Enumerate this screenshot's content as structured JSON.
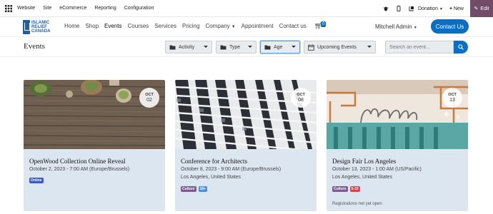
{
  "adminbar": {
    "menu": [
      "Website",
      "Site",
      "eCommerce",
      "Reporting",
      "Configuration"
    ],
    "donation_label": "Donation",
    "new_label": "New",
    "edit_label": "Edit"
  },
  "header": {
    "logo_lines": [
      "ISLAMIC",
      "RELIEF",
      "CANADA"
    ],
    "nav": [
      "Home",
      "Shop",
      "Events",
      "Courses",
      "Services",
      "Pricing",
      "Company",
      "Appointment",
      "Contact us"
    ],
    "cart_count": "0",
    "user_name": "Mitchell Admin",
    "contact_button": "Contact Us"
  },
  "page": {
    "title": "Events",
    "filters": {
      "activity": "Activity",
      "type": "Type",
      "age": "Age",
      "period": "Upcoming Events"
    },
    "search_placeholder": "Search an event..."
  },
  "events": [
    {
      "month": "OCT",
      "day": "02",
      "title": "OpenWood Collection Online Reveal",
      "datetime": "October 2, 2023 - 7:00 AM (Europe/Brussels)",
      "location": "",
      "tags": [
        {
          "label": "Online",
          "color": "#3a5bc7"
        }
      ]
    },
    {
      "month": "OCT",
      "day": "08",
      "title": "Conference for Architects",
      "datetime": "October 8, 2023 - 9:00 AM (Europe/Brussels)",
      "location": "Los Angeles, United States",
      "tags": [
        {
          "label": "Culture",
          "color": "#7b5b8f"
        },
        {
          "label": "18+",
          "color": "#4a90d9"
        }
      ]
    },
    {
      "month": "OCT",
      "day": "13",
      "title": "Design Fair Los Angeles",
      "datetime": "October 13, 2023 - 1:00 AM (US/Pacific)",
      "location": "Los Angeles, United States",
      "tags": [
        {
          "label": "Culture",
          "color": "#7b5b8f"
        },
        {
          "label": "5-10",
          "color": "#d64550"
        }
      ],
      "note": "Registrations not yet open"
    }
  ],
  "colors": {
    "primary": "#0a6ec4",
    "edit": "#714b67",
    "card_bg": "#dce6f1"
  }
}
